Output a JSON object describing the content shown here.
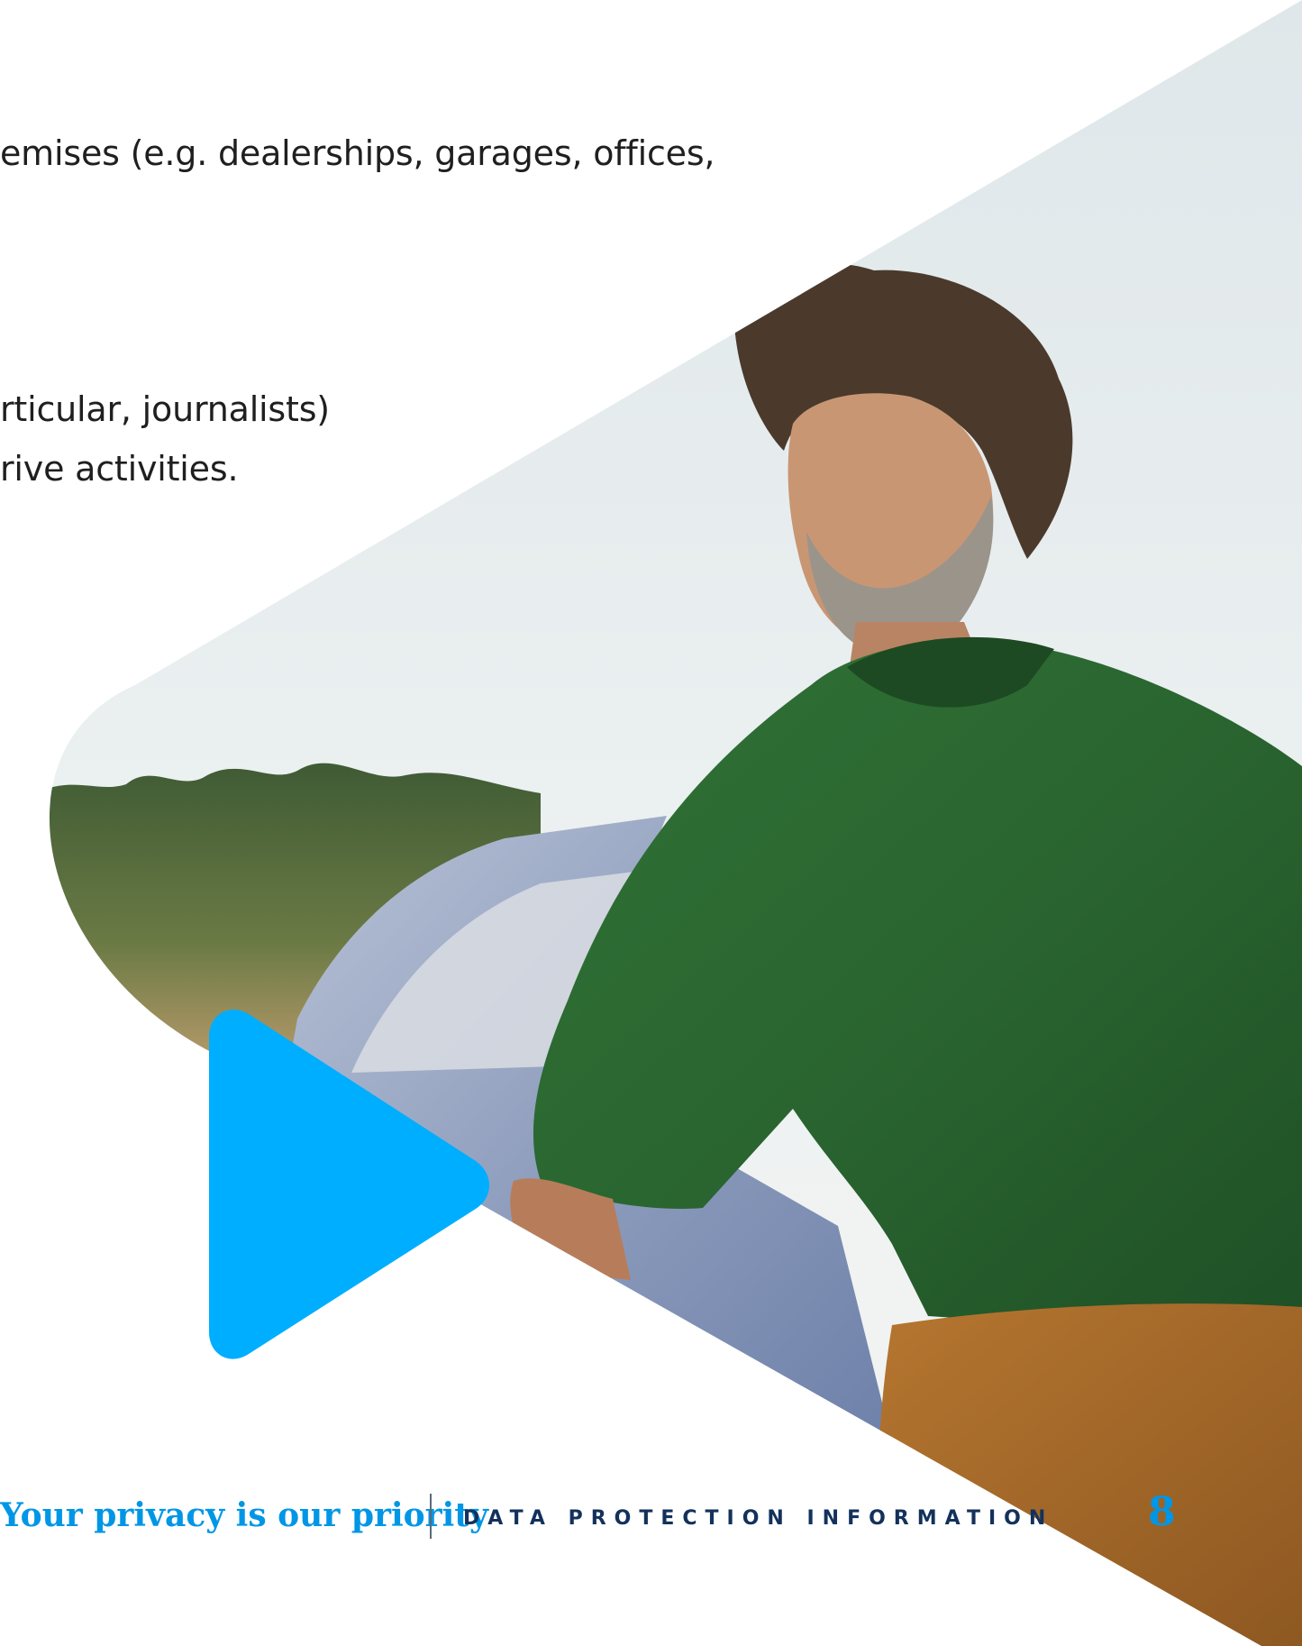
{
  "body_text": {
    "line1": "emises (e.g. dealerships, garages, offices,",
    "line2": "rticular, journalists)",
    "line3": "rive activities."
  },
  "footer": {
    "tagline": "Your privacy is our priority",
    "section": "DATA PROTECTION INFORMATION",
    "page_number": "8"
  },
  "colors": {
    "accent_blue": "#00aeff",
    "footer_blue": "#0096e6",
    "footer_navy": "#13315c",
    "sweater_green": "#2c6b33",
    "trousers_brown": "#a5682a",
    "sky": "#e4ebee"
  },
  "icons": {
    "play_shape": "play-icon"
  }
}
